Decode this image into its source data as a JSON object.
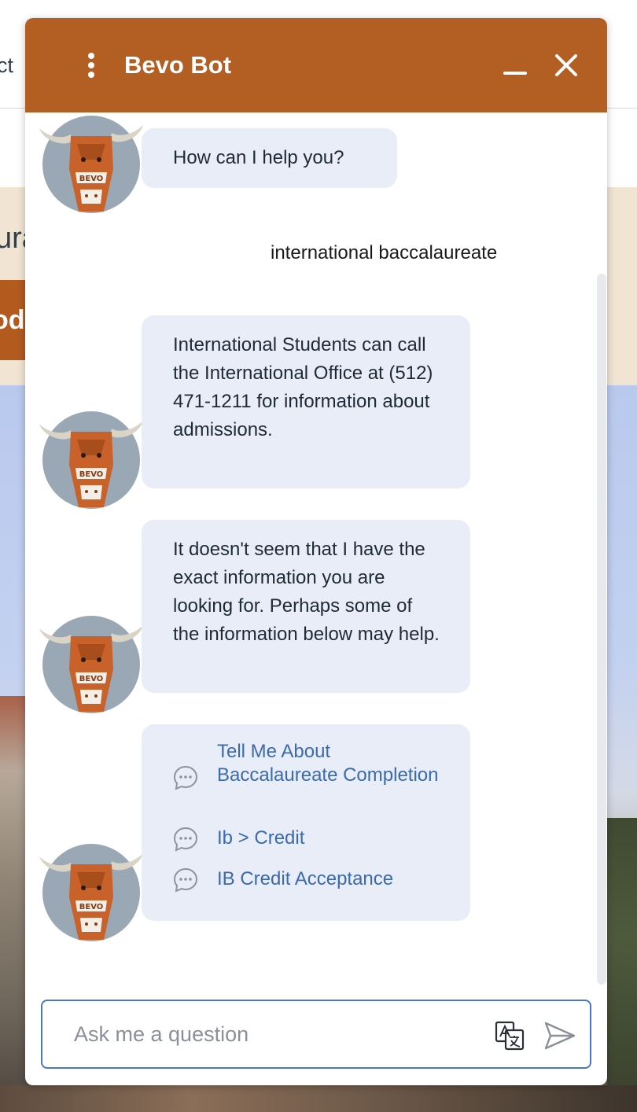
{
  "background": {
    "nav_text": "ct",
    "band_text": "ura",
    "band_button": "oda"
  },
  "chat": {
    "title": "Bevo Bot",
    "messages": [
      {
        "from": "bot",
        "text": "How can I help you?"
      },
      {
        "from": "user",
        "text": "international baccalaureate"
      },
      {
        "from": "bot",
        "text": "International Students can call the International Office at (512) 471-1211 for information about admissions."
      },
      {
        "from": "bot",
        "text": "It doesn't seem that I have the exact information you are looking for. Perhaps some of the information below may help."
      }
    ],
    "suggestions": [
      {
        "label": "Tell Me About Baccalaureate Completion"
      },
      {
        "label": "Ib > Credit"
      },
      {
        "label": "IB Credit Acceptance"
      }
    ],
    "avatar_label": "BEVO",
    "input": {
      "placeholder": "Ask me a question",
      "value": ""
    }
  },
  "colors": {
    "header": "#b35f24",
    "bubble": "#e8edf7",
    "link": "#3b6aae",
    "input_border": "#4a78c8"
  },
  "icons": {
    "menu": "vertical-dots-icon",
    "minimize": "minimize-icon",
    "close": "close-icon",
    "suggestion": "chat-bubble-icon",
    "translate": "translate-icon",
    "send": "send-icon"
  }
}
